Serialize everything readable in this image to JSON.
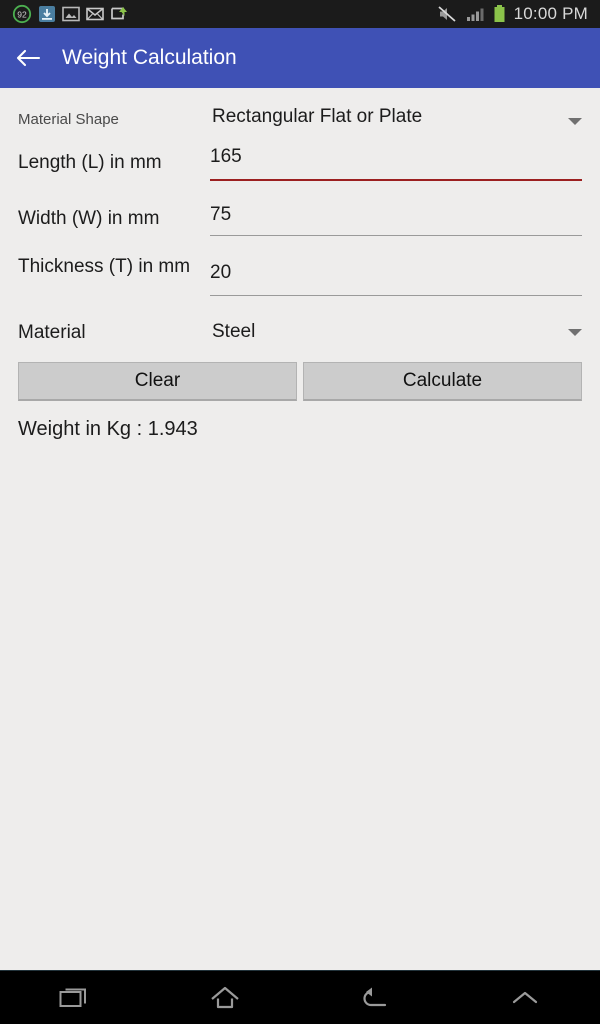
{
  "status_bar": {
    "icons": [
      {
        "name": "battery-saver-92-icon",
        "label": "92"
      },
      {
        "name": "download-manager-icon",
        "label": ""
      },
      {
        "name": "screenshot-image-icon",
        "label": ""
      },
      {
        "name": "email-icon",
        "label": ""
      },
      {
        "name": "screen-share-icon",
        "label": ""
      }
    ],
    "right_icons": [
      {
        "name": "mute-icon",
        "label": ""
      },
      {
        "name": "signal-bars-icon",
        "label": ""
      },
      {
        "name": "battery-icon",
        "label": ""
      }
    ],
    "clock": "10:00 PM",
    "background": "#1b1b1b",
    "battery_color": "#8bc34a"
  },
  "app_bar": {
    "title": "Weight Calculation",
    "back_icon": "arrow-left-icon",
    "background": "#3f51b5",
    "text_color": "#ffffff"
  },
  "form": {
    "shape_field": {
      "label": "Material Shape",
      "value": "Rectangular Flat or Plate",
      "dropdown_icon": "chevron-down-icon"
    },
    "length_field": {
      "label": "Length (L) in mm",
      "value": "165",
      "underline_color": "#9c2020",
      "focused": true
    },
    "width_field": {
      "label": "Width (W) in mm",
      "value": "75",
      "underline_color": "#9a9a9a",
      "focused": false
    },
    "thickness_field": {
      "label": "Thickness (T) in mm",
      "value": "20",
      "underline_color": "#9a9a9a",
      "focused": false
    },
    "material_field": {
      "label": "Material",
      "value": "Steel",
      "dropdown_icon": "chevron-down-icon"
    }
  },
  "actions": {
    "clear_label": "Clear",
    "calculate_label": "Calculate",
    "button_background": "#cccccc"
  },
  "result": {
    "text": "Weight in Kg : 1.943"
  },
  "nav_bar": {
    "recents_icon": "recents-icon",
    "home_icon": "home-icon",
    "back_icon": "back-arrow-icon",
    "expand_icon": "chevron-up-icon",
    "background": "#000000"
  }
}
